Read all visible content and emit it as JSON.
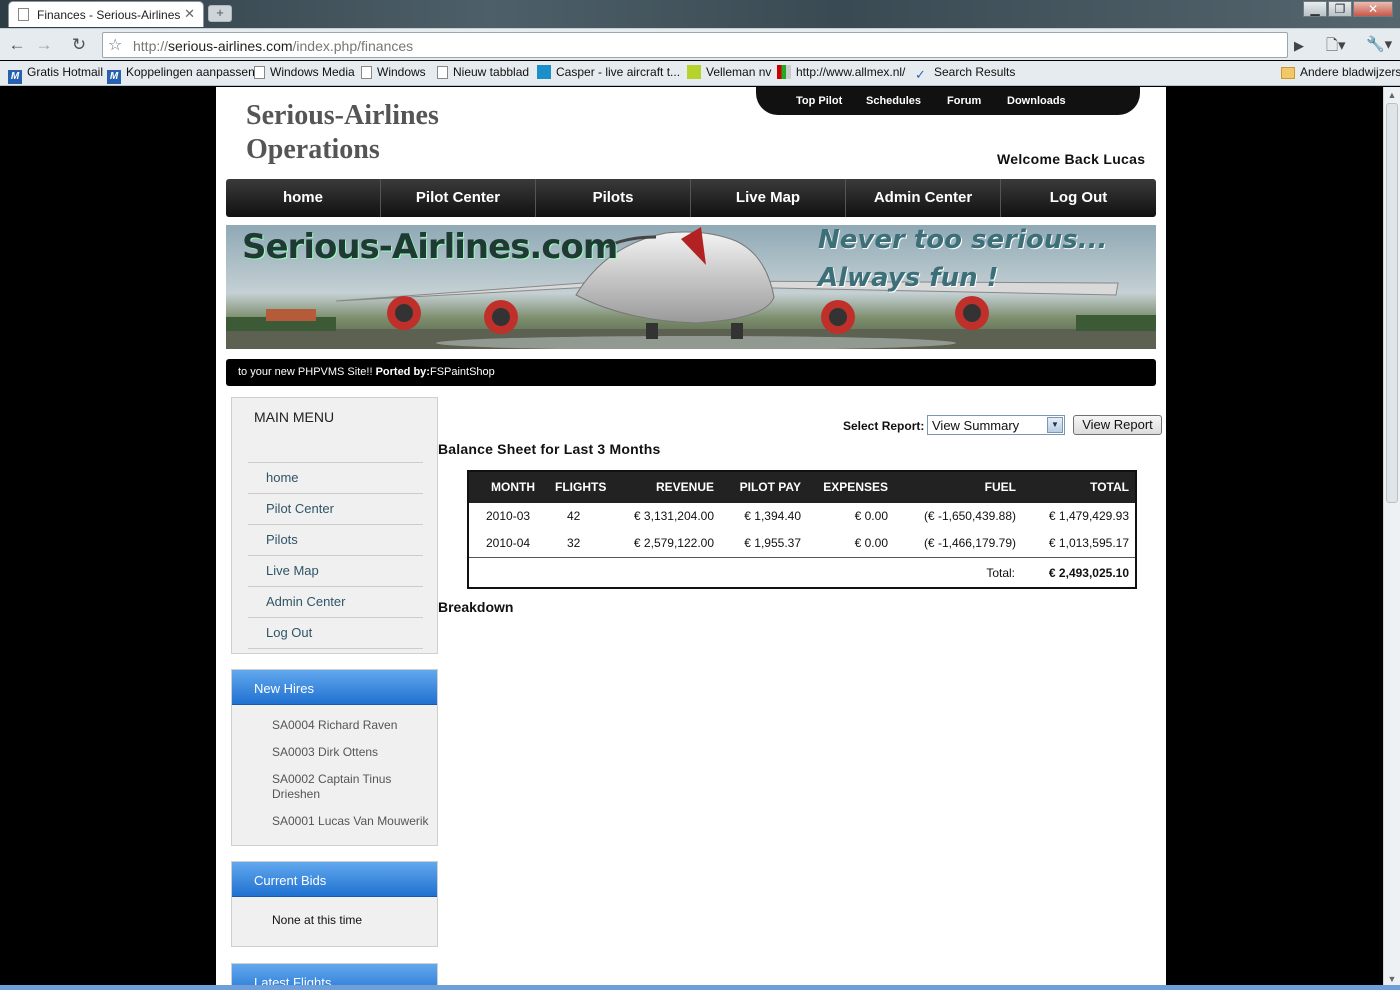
{
  "browser": {
    "tab_title": "Finances - Serious-Airlines",
    "url_scheme": "http://",
    "url_host": "serious-airlines.com",
    "url_path": "/index.php/finances",
    "bookmarks": [
      {
        "label": "Gratis Hotmail",
        "icon": "msn-icon"
      },
      {
        "label": "Koppelingen aanpassen",
        "icon": "msn-icon"
      },
      {
        "label": "Windows Media",
        "icon": "page-icon"
      },
      {
        "label": "Windows",
        "icon": "page-icon"
      },
      {
        "label": "Nieuw tabblad",
        "icon": "page-icon"
      },
      {
        "label": "Casper - live aircraft t...",
        "icon": "casper-icon"
      },
      {
        "label": "Velleman nv",
        "icon": "velleman-icon"
      },
      {
        "label": "http://www.allmex.nl/",
        "icon": "allmex-icon"
      },
      {
        "label": "Search Results",
        "icon": "search-results-icon"
      }
    ],
    "other_bookmarks": "Andere bladwijzers"
  },
  "site": {
    "logo_line1": "Serious-Airlines",
    "logo_line2": "Operations",
    "top_nav": [
      "Top Pilot",
      "Schedules",
      "Forum",
      "Downloads"
    ],
    "welcome": "Welcome Back Lucas",
    "main_nav": [
      "home",
      "Pilot Center",
      "Pilots",
      "Live Map",
      "Admin Center",
      "Log Out"
    ],
    "banner_title": "Serious-Airlines.com",
    "banner_slogan1": "Never too serious...",
    "banner_slogan2": "Always fun !",
    "ticker_text": "to your new PHPVMS Site!!",
    "ticker_bold": "Ported by:",
    "ticker_author": "FSPaintShop"
  },
  "sidebar": {
    "main_menu_title": "MAIN MENU",
    "main_menu": [
      "home",
      "Pilot Center",
      "Pilots",
      "Live Map",
      "Admin Center",
      "Log Out"
    ],
    "new_hires_title": "New Hires",
    "new_hires": [
      "SA0004 Richard Raven",
      "SA0003 Dirk Ottens",
      "SA0002 Captain Tinus Drieshen",
      "SA0001 Lucas Van Mouwerik"
    ],
    "current_bids_title": "Current Bids",
    "current_bids_text": "None at this time",
    "latest_flights_title": "Latest Flights"
  },
  "finances": {
    "select_label": "Select Report:",
    "select_value": "View Summary",
    "view_report_button": "View Report",
    "balance_title": "Balance Sheet for Last 3 Months",
    "columns": [
      "MONTH",
      "FLIGHTS",
      "REVENUE",
      "PILOT PAY",
      "EXPENSES",
      "FUEL",
      "TOTAL"
    ],
    "rows": [
      {
        "month": "2010-03",
        "flights": "42",
        "revenue": "€ 3,131,204.00",
        "pilot_pay": "€ 1,394.40",
        "expenses": "€ 0.00",
        "fuel": "(€ -1,650,439.88)",
        "total": "€ 1,479,429.93"
      },
      {
        "month": "2010-04",
        "flights": "32",
        "revenue": "€ 2,579,122.00",
        "pilot_pay": "€ 1,955.37",
        "expenses": "€ 0.00",
        "fuel": "(€ -1,466,179.79)",
        "total": "€ 1,013,595.17"
      }
    ],
    "total_label": "Total:",
    "total_value": "€ 2,493,025.10",
    "breakdown_title": "Breakdown"
  }
}
